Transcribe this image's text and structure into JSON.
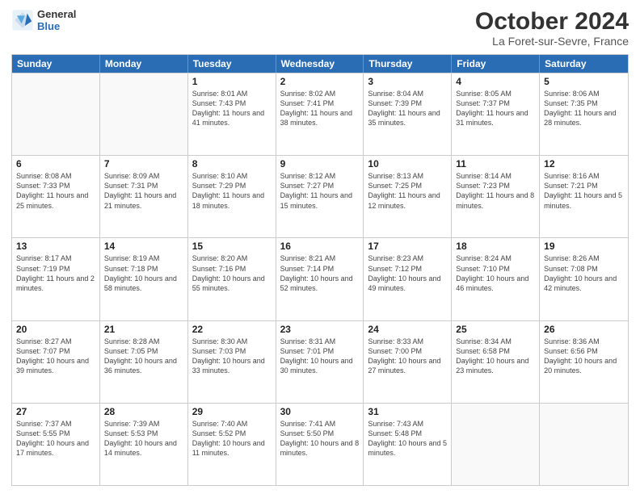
{
  "header": {
    "logo_line1": "General",
    "logo_line2": "Blue",
    "month": "October 2024",
    "location": "La Foret-sur-Sevre, France"
  },
  "weekdays": [
    "Sunday",
    "Monday",
    "Tuesday",
    "Wednesday",
    "Thursday",
    "Friday",
    "Saturday"
  ],
  "weeks": [
    [
      {
        "day": "",
        "sunrise": "",
        "sunset": "",
        "daylight": ""
      },
      {
        "day": "",
        "sunrise": "",
        "sunset": "",
        "daylight": ""
      },
      {
        "day": "1",
        "sunrise": "Sunrise: 8:01 AM",
        "sunset": "Sunset: 7:43 PM",
        "daylight": "Daylight: 11 hours and 41 minutes."
      },
      {
        "day": "2",
        "sunrise": "Sunrise: 8:02 AM",
        "sunset": "Sunset: 7:41 PM",
        "daylight": "Daylight: 11 hours and 38 minutes."
      },
      {
        "day": "3",
        "sunrise": "Sunrise: 8:04 AM",
        "sunset": "Sunset: 7:39 PM",
        "daylight": "Daylight: 11 hours and 35 minutes."
      },
      {
        "day": "4",
        "sunrise": "Sunrise: 8:05 AM",
        "sunset": "Sunset: 7:37 PM",
        "daylight": "Daylight: 11 hours and 31 minutes."
      },
      {
        "day": "5",
        "sunrise": "Sunrise: 8:06 AM",
        "sunset": "Sunset: 7:35 PM",
        "daylight": "Daylight: 11 hours and 28 minutes."
      }
    ],
    [
      {
        "day": "6",
        "sunrise": "Sunrise: 8:08 AM",
        "sunset": "Sunset: 7:33 PM",
        "daylight": "Daylight: 11 hours and 25 minutes."
      },
      {
        "day": "7",
        "sunrise": "Sunrise: 8:09 AM",
        "sunset": "Sunset: 7:31 PM",
        "daylight": "Daylight: 11 hours and 21 minutes."
      },
      {
        "day": "8",
        "sunrise": "Sunrise: 8:10 AM",
        "sunset": "Sunset: 7:29 PM",
        "daylight": "Daylight: 11 hours and 18 minutes."
      },
      {
        "day": "9",
        "sunrise": "Sunrise: 8:12 AM",
        "sunset": "Sunset: 7:27 PM",
        "daylight": "Daylight: 11 hours and 15 minutes."
      },
      {
        "day": "10",
        "sunrise": "Sunrise: 8:13 AM",
        "sunset": "Sunset: 7:25 PM",
        "daylight": "Daylight: 11 hours and 12 minutes."
      },
      {
        "day": "11",
        "sunrise": "Sunrise: 8:14 AM",
        "sunset": "Sunset: 7:23 PM",
        "daylight": "Daylight: 11 hours and 8 minutes."
      },
      {
        "day": "12",
        "sunrise": "Sunrise: 8:16 AM",
        "sunset": "Sunset: 7:21 PM",
        "daylight": "Daylight: 11 hours and 5 minutes."
      }
    ],
    [
      {
        "day": "13",
        "sunrise": "Sunrise: 8:17 AM",
        "sunset": "Sunset: 7:19 PM",
        "daylight": "Daylight: 11 hours and 2 minutes."
      },
      {
        "day": "14",
        "sunrise": "Sunrise: 8:19 AM",
        "sunset": "Sunset: 7:18 PM",
        "daylight": "Daylight: 10 hours and 58 minutes."
      },
      {
        "day": "15",
        "sunrise": "Sunrise: 8:20 AM",
        "sunset": "Sunset: 7:16 PM",
        "daylight": "Daylight: 10 hours and 55 minutes."
      },
      {
        "day": "16",
        "sunrise": "Sunrise: 8:21 AM",
        "sunset": "Sunset: 7:14 PM",
        "daylight": "Daylight: 10 hours and 52 minutes."
      },
      {
        "day": "17",
        "sunrise": "Sunrise: 8:23 AM",
        "sunset": "Sunset: 7:12 PM",
        "daylight": "Daylight: 10 hours and 49 minutes."
      },
      {
        "day": "18",
        "sunrise": "Sunrise: 8:24 AM",
        "sunset": "Sunset: 7:10 PM",
        "daylight": "Daylight: 10 hours and 46 minutes."
      },
      {
        "day": "19",
        "sunrise": "Sunrise: 8:26 AM",
        "sunset": "Sunset: 7:08 PM",
        "daylight": "Daylight: 10 hours and 42 minutes."
      }
    ],
    [
      {
        "day": "20",
        "sunrise": "Sunrise: 8:27 AM",
        "sunset": "Sunset: 7:07 PM",
        "daylight": "Daylight: 10 hours and 39 minutes."
      },
      {
        "day": "21",
        "sunrise": "Sunrise: 8:28 AM",
        "sunset": "Sunset: 7:05 PM",
        "daylight": "Daylight: 10 hours and 36 minutes."
      },
      {
        "day": "22",
        "sunrise": "Sunrise: 8:30 AM",
        "sunset": "Sunset: 7:03 PM",
        "daylight": "Daylight: 10 hours and 33 minutes."
      },
      {
        "day": "23",
        "sunrise": "Sunrise: 8:31 AM",
        "sunset": "Sunset: 7:01 PM",
        "daylight": "Daylight: 10 hours and 30 minutes."
      },
      {
        "day": "24",
        "sunrise": "Sunrise: 8:33 AM",
        "sunset": "Sunset: 7:00 PM",
        "daylight": "Daylight: 10 hours and 27 minutes."
      },
      {
        "day": "25",
        "sunrise": "Sunrise: 8:34 AM",
        "sunset": "Sunset: 6:58 PM",
        "daylight": "Daylight: 10 hours and 23 minutes."
      },
      {
        "day": "26",
        "sunrise": "Sunrise: 8:36 AM",
        "sunset": "Sunset: 6:56 PM",
        "daylight": "Daylight: 10 hours and 20 minutes."
      }
    ],
    [
      {
        "day": "27",
        "sunrise": "Sunrise: 7:37 AM",
        "sunset": "Sunset: 5:55 PM",
        "daylight": "Daylight: 10 hours and 17 minutes."
      },
      {
        "day": "28",
        "sunrise": "Sunrise: 7:39 AM",
        "sunset": "Sunset: 5:53 PM",
        "daylight": "Daylight: 10 hours and 14 minutes."
      },
      {
        "day": "29",
        "sunrise": "Sunrise: 7:40 AM",
        "sunset": "Sunset: 5:52 PM",
        "daylight": "Daylight: 10 hours and 11 minutes."
      },
      {
        "day": "30",
        "sunrise": "Sunrise: 7:41 AM",
        "sunset": "Sunset: 5:50 PM",
        "daylight": "Daylight: 10 hours and 8 minutes."
      },
      {
        "day": "31",
        "sunrise": "Sunrise: 7:43 AM",
        "sunset": "Sunset: 5:48 PM",
        "daylight": "Daylight: 10 hours and 5 minutes."
      },
      {
        "day": "",
        "sunrise": "",
        "sunset": "",
        "daylight": ""
      },
      {
        "day": "",
        "sunrise": "",
        "sunset": "",
        "daylight": ""
      }
    ]
  ]
}
